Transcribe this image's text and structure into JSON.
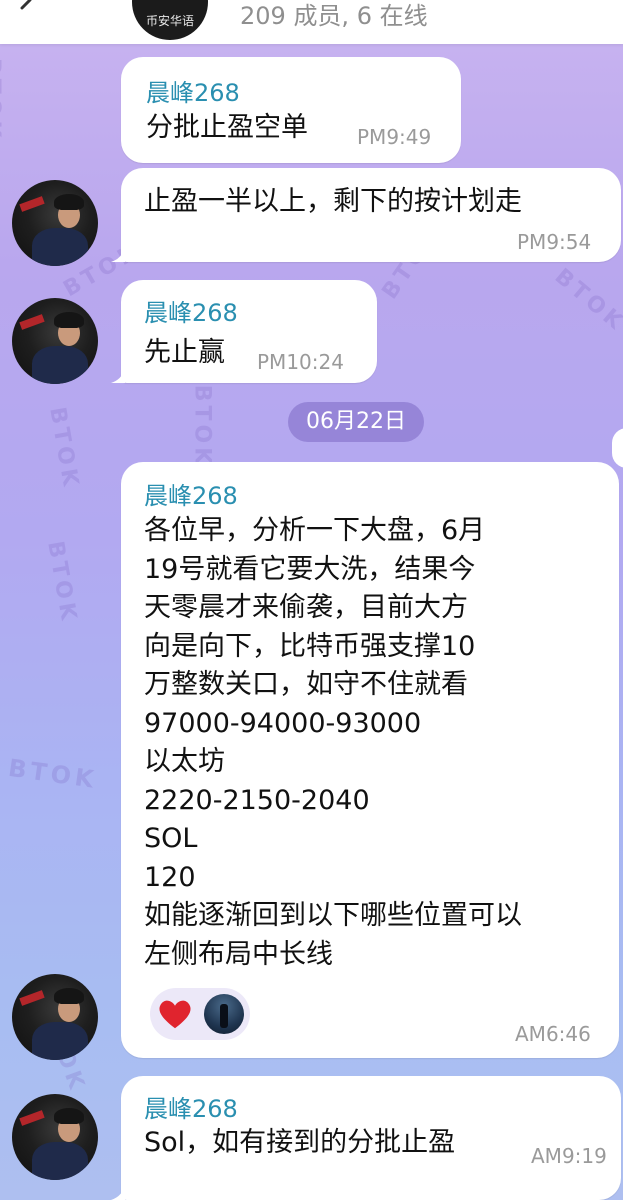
{
  "header": {
    "group_avatar_text": "币安华语",
    "member_status": "209 成员, 6 在线"
  },
  "date_separator": "06月22日",
  "background_watermark": "BTOK",
  "messages": [
    {
      "sender": "晨峰268",
      "text": "分批止盈空单",
      "time": "PM9:49"
    },
    {
      "sender": "",
      "text": "止盈一半以上，剩下的按计划走",
      "time": "PM9:54"
    },
    {
      "sender": "晨峰268",
      "text": "先止赢",
      "time": "PM10:24"
    },
    {
      "sender": "晨峰268",
      "text": "各位早，分析一下大盘，6月\n19号就看它要大洗，结果今\n天零晨才来偷袭，目前大方\n向是向下，比特币强支撑10\n万整数关口，如守不住就看\n97000-94000-93000\n以太坊\n2220-2150-2040\nSOL\n120\n如能逐渐回到以下哪些位置可以\n左侧布局中长线",
      "time": "AM6:46",
      "reactions": [
        {
          "icon": "heart-icon",
          "color": "#e0242e"
        },
        {
          "icon": "user-avatar"
        }
      ]
    },
    {
      "sender": "晨峰268",
      "text": "Sol，如有接到的分批止盈",
      "time": "AM9:19"
    }
  ],
  "colors": {
    "sender_name": "#2a8fb0",
    "date_chip_bg": "#7b68c4",
    "bubble_bg": "#ffffff"
  }
}
